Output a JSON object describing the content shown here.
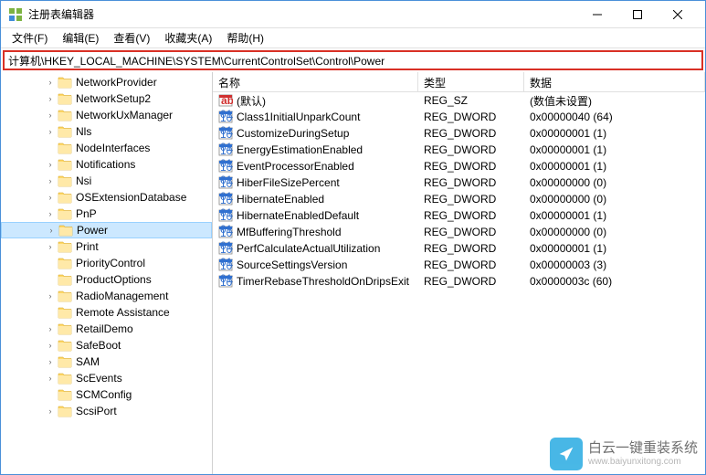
{
  "window": {
    "title": "注册表编辑器"
  },
  "menu": {
    "file": "文件(F)",
    "edit": "编辑(E)",
    "view": "查看(V)",
    "favorites": "收藏夹(A)",
    "help": "帮助(H)"
  },
  "address": "计算机\\HKEY_LOCAL_MACHINE\\SYSTEM\\CurrentControlSet\\Control\\Power",
  "tree": [
    {
      "label": "NetworkProvider",
      "expandable": true
    },
    {
      "label": "NetworkSetup2",
      "expandable": true
    },
    {
      "label": "NetworkUxManager",
      "expandable": true
    },
    {
      "label": "Nls",
      "expandable": true
    },
    {
      "label": "NodeInterfaces",
      "expandable": false
    },
    {
      "label": "Notifications",
      "expandable": true
    },
    {
      "label": "Nsi",
      "expandable": true
    },
    {
      "label": "OSExtensionDatabase",
      "expandable": true
    },
    {
      "label": "PnP",
      "expandable": true
    },
    {
      "label": "Power",
      "expandable": true,
      "selected": true
    },
    {
      "label": "Print",
      "expandable": true
    },
    {
      "label": "PriorityControl",
      "expandable": false
    },
    {
      "label": "ProductOptions",
      "expandable": false
    },
    {
      "label": "RadioManagement",
      "expandable": true
    },
    {
      "label": "Remote Assistance",
      "expandable": false
    },
    {
      "label": "RetailDemo",
      "expandable": true
    },
    {
      "label": "SafeBoot",
      "expandable": true
    },
    {
      "label": "SAM",
      "expandable": true
    },
    {
      "label": "ScEvents",
      "expandable": true
    },
    {
      "label": "SCMConfig",
      "expandable": false
    },
    {
      "label": "ScsiPort",
      "expandable": true
    }
  ],
  "columns": {
    "name": "名称",
    "type": "类型",
    "data": "数据"
  },
  "values": [
    {
      "name": "(默认)",
      "type": "REG_SZ",
      "data": "(数值未设置)",
      "icon": "string"
    },
    {
      "name": "Class1InitialUnparkCount",
      "type": "REG_DWORD",
      "data": "0x00000040 (64)",
      "icon": "dword"
    },
    {
      "name": "CustomizeDuringSetup",
      "type": "REG_DWORD",
      "data": "0x00000001 (1)",
      "icon": "dword"
    },
    {
      "name": "EnergyEstimationEnabled",
      "type": "REG_DWORD",
      "data": "0x00000001 (1)",
      "icon": "dword"
    },
    {
      "name": "EventProcessorEnabled",
      "type": "REG_DWORD",
      "data": "0x00000001 (1)",
      "icon": "dword"
    },
    {
      "name": "HiberFileSizePercent",
      "type": "REG_DWORD",
      "data": "0x00000000 (0)",
      "icon": "dword"
    },
    {
      "name": "HibernateEnabled",
      "type": "REG_DWORD",
      "data": "0x00000000 (0)",
      "icon": "dword"
    },
    {
      "name": "HibernateEnabledDefault",
      "type": "REG_DWORD",
      "data": "0x00000001 (1)",
      "icon": "dword"
    },
    {
      "name": "MfBufferingThreshold",
      "type": "REG_DWORD",
      "data": "0x00000000 (0)",
      "icon": "dword"
    },
    {
      "name": "PerfCalculateActualUtilization",
      "type": "REG_DWORD",
      "data": "0x00000001 (1)",
      "icon": "dword"
    },
    {
      "name": "SourceSettingsVersion",
      "type": "REG_DWORD",
      "data": "0x00000003 (3)",
      "icon": "dword"
    },
    {
      "name": "TimerRebaseThresholdOnDripsExit",
      "type": "REG_DWORD",
      "data": "0x0000003c (60)",
      "icon": "dword"
    }
  ],
  "watermark": {
    "line1": "白云一键重装系统",
    "line2": "www.baiyunxitong.com"
  }
}
